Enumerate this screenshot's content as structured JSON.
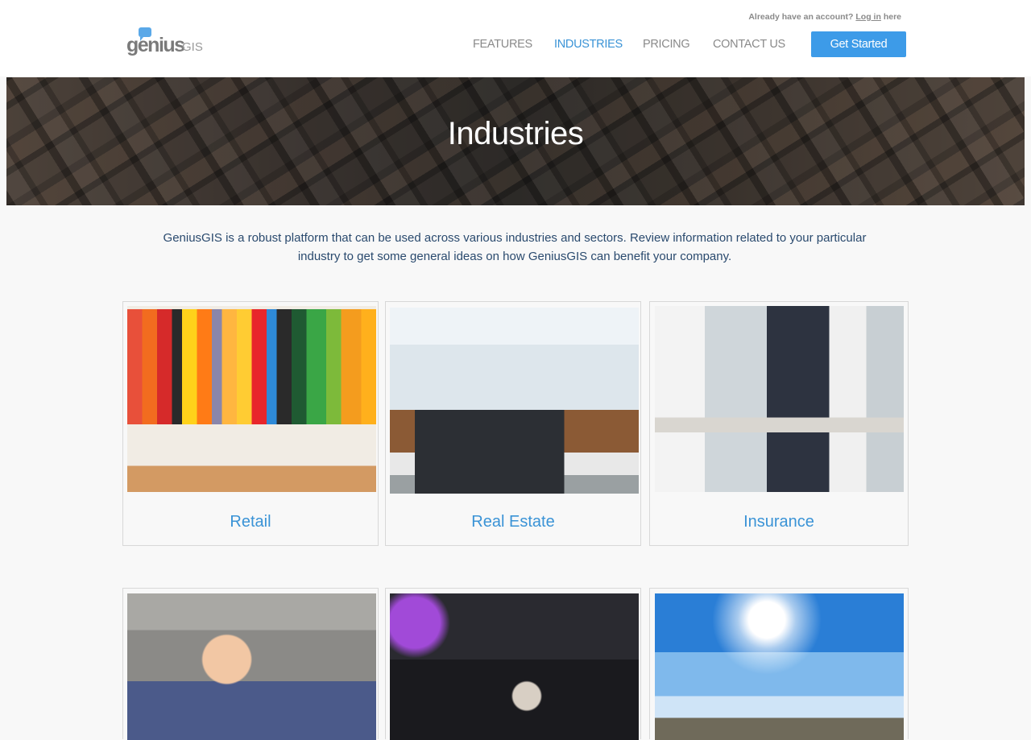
{
  "header": {
    "logo_text": "genius",
    "logo_suffix": "GIS",
    "account_prompt": "Already have an account?",
    "login_link": "Log in",
    "account_suffix": "here",
    "nav": [
      {
        "label": "FEATURES",
        "active": false
      },
      {
        "label": "INDUSTRIES",
        "active": true
      },
      {
        "label": "PRICING",
        "active": false
      },
      {
        "label": "CONTACT US",
        "active": false
      }
    ],
    "cta_label": "Get Started"
  },
  "hero": {
    "title": "Industries"
  },
  "intro": "GeniusGIS is a robust platform that can be used across various industries and sectors. Review information related to your particular industry to get some general ideas on how GeniusGIS can benefit your company.",
  "cards": [
    {
      "label": "Retail",
      "image": "clothing-rack-photo"
    },
    {
      "label": "Real Estate",
      "image": "modern-house-photo"
    },
    {
      "label": "Insurance",
      "image": "business-meeting-photo"
    },
    {
      "label": "",
      "image": "photographer-photo"
    },
    {
      "label": "",
      "image": "dj-decks-photo"
    },
    {
      "label": "",
      "image": "hikers-photo"
    }
  ],
  "colors": {
    "accent": "#3d9be8",
    "nav_active": "#3a93d6",
    "intro_text": "#2a4a6e"
  }
}
